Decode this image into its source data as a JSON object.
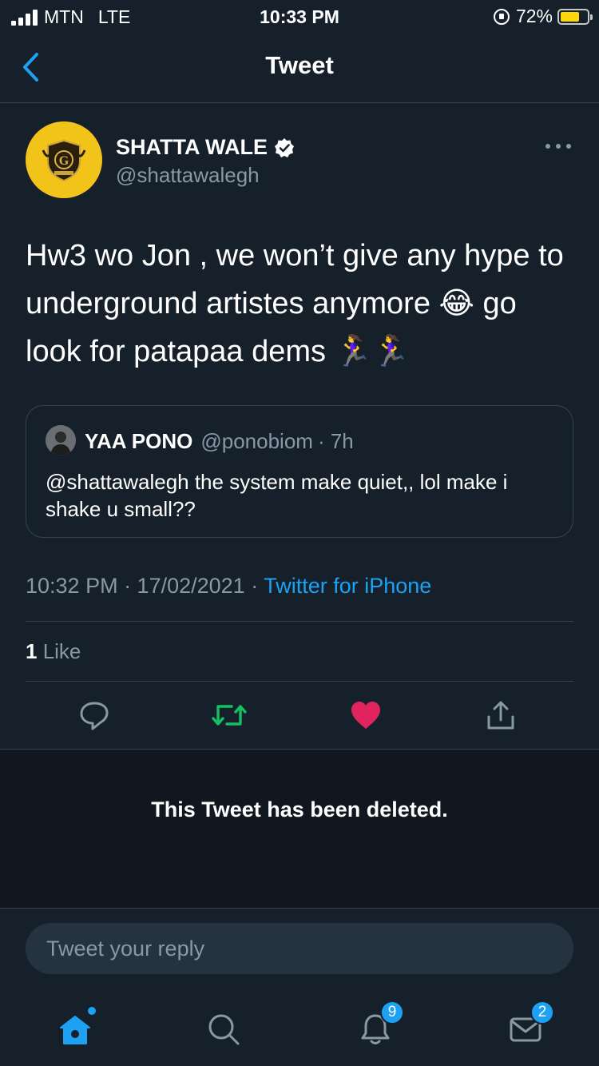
{
  "status_bar": {
    "carrier": "MTN",
    "network": "LTE",
    "time": "10:33 PM",
    "battery": "72%",
    "battery_level": 0.72,
    "battery_color": "#ffd60a"
  },
  "nav": {
    "title": "Tweet",
    "back_icon": "chevron-left-icon"
  },
  "tweet": {
    "display_name": "SHATTA WALE",
    "handle": "@shattawalegh",
    "verified": true,
    "text": "Hw3 wo Jon , we won’t give any hype to underground artistes anymore 😂 go look for patapaa dems 🏃‍♀️🏃‍♀️",
    "quote": {
      "name": "YAA PONO",
      "handle": "@ponobiom",
      "time": "· 7h",
      "text": "@shattawalegh the system make quiet,, lol make i shake u small??"
    },
    "timestamp": "10:32 PM · 17/02/2021 · ",
    "source": "Twitter for iPhone",
    "like_count": "1",
    "like_label": " Like"
  },
  "actions": {
    "reply_icon": "reply-icon",
    "retweet_icon": "retweet-icon",
    "like_icon": "heart-icon",
    "share_icon": "share-icon",
    "retweet_color": "#17bf63",
    "like_color": "#e0245e"
  },
  "deleted_notice": "This Tweet has been deleted.",
  "reply": {
    "placeholder": "Tweet your reply"
  },
  "tabbar": {
    "notifications_badge": "9",
    "messages_badge": "2",
    "accent": "#1da1f2"
  }
}
